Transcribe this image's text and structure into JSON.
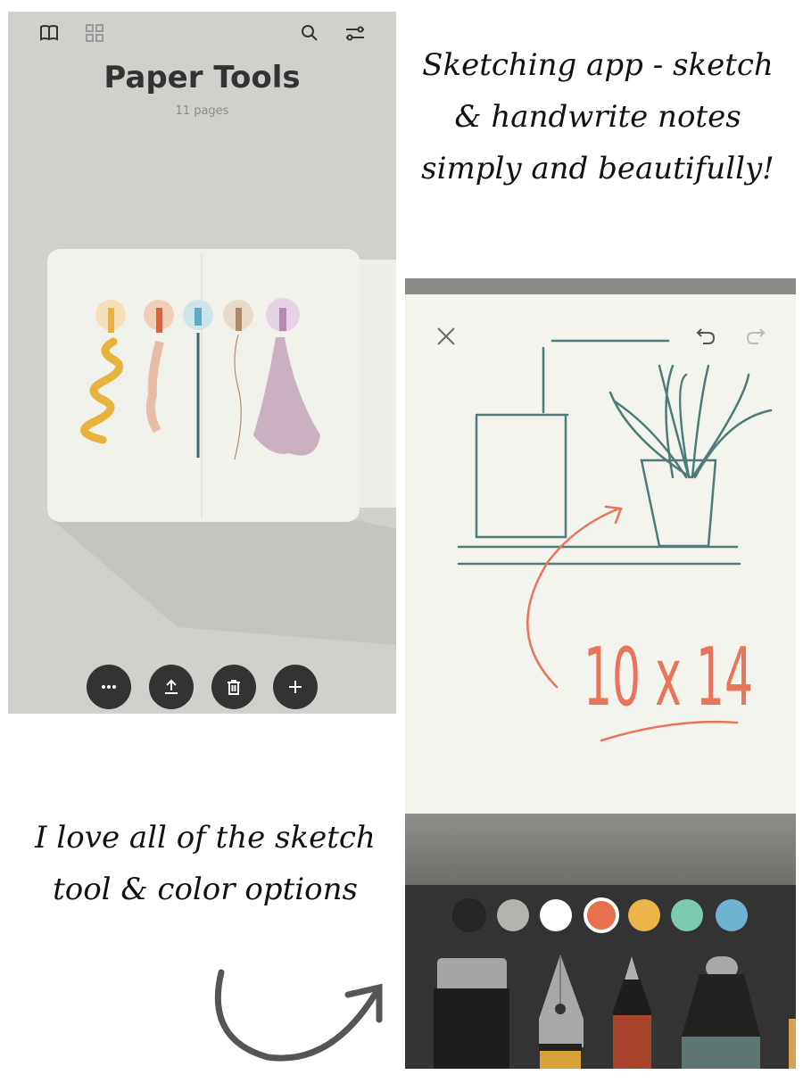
{
  "library": {
    "title": "Paper Tools",
    "subtitle": "11 pages",
    "icons": [
      "book-icon",
      "grid-icon",
      "search-icon",
      "sliders-icon"
    ],
    "actions": [
      "more-icon",
      "share-icon",
      "trash-icon",
      "plus-icon"
    ],
    "tool_colors": [
      "#e8b33c",
      "#e0603a",
      "#5ea8c8",
      "#b08a68",
      "#b889b0"
    ]
  },
  "caption_top": "Sketching app - sketch & handwrite notes simply and beautifully!",
  "caption_bottom": "I love all of the sketch tool & color options",
  "editor": {
    "sketch_text": "10 x 14",
    "stroke_colors": {
      "teal": "#4e7a7a",
      "orange": "#e8745a"
    },
    "palette": [
      "#262624",
      "#b4b4ae",
      "#ffffff",
      "#e8704c",
      "#ebb54a",
      "#7ccbb0",
      "#6fb2d2"
    ],
    "selected_color": "#e8704c",
    "tools": [
      "eraser",
      "fountain-pen",
      "pencil",
      "marker"
    ]
  }
}
